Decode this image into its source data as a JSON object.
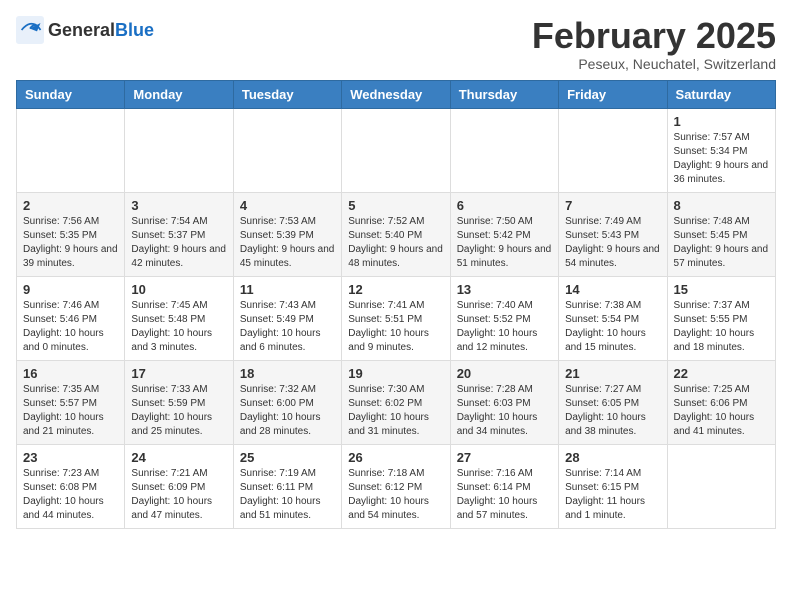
{
  "logo": {
    "general": "General",
    "blue": "Blue"
  },
  "title": "February 2025",
  "subtitle": "Peseux, Neuchatel, Switzerland",
  "weekdays": [
    "Sunday",
    "Monday",
    "Tuesday",
    "Wednesday",
    "Thursday",
    "Friday",
    "Saturday"
  ],
  "weeks": [
    [
      null,
      null,
      null,
      null,
      null,
      null,
      {
        "day": "1",
        "sunrise": "Sunrise: 7:57 AM",
        "sunset": "Sunset: 5:34 PM",
        "daylight": "Daylight: 9 hours and 36 minutes."
      }
    ],
    [
      {
        "day": "2",
        "sunrise": "Sunrise: 7:56 AM",
        "sunset": "Sunset: 5:35 PM",
        "daylight": "Daylight: 9 hours and 39 minutes."
      },
      {
        "day": "3",
        "sunrise": "Sunrise: 7:54 AM",
        "sunset": "Sunset: 5:37 PM",
        "daylight": "Daylight: 9 hours and 42 minutes."
      },
      {
        "day": "4",
        "sunrise": "Sunrise: 7:53 AM",
        "sunset": "Sunset: 5:39 PM",
        "daylight": "Daylight: 9 hours and 45 minutes."
      },
      {
        "day": "5",
        "sunrise": "Sunrise: 7:52 AM",
        "sunset": "Sunset: 5:40 PM",
        "daylight": "Daylight: 9 hours and 48 minutes."
      },
      {
        "day": "6",
        "sunrise": "Sunrise: 7:50 AM",
        "sunset": "Sunset: 5:42 PM",
        "daylight": "Daylight: 9 hours and 51 minutes."
      },
      {
        "day": "7",
        "sunrise": "Sunrise: 7:49 AM",
        "sunset": "Sunset: 5:43 PM",
        "daylight": "Daylight: 9 hours and 54 minutes."
      },
      {
        "day": "8",
        "sunrise": "Sunrise: 7:48 AM",
        "sunset": "Sunset: 5:45 PM",
        "daylight": "Daylight: 9 hours and 57 minutes."
      }
    ],
    [
      {
        "day": "9",
        "sunrise": "Sunrise: 7:46 AM",
        "sunset": "Sunset: 5:46 PM",
        "daylight": "Daylight: 10 hours and 0 minutes."
      },
      {
        "day": "10",
        "sunrise": "Sunrise: 7:45 AM",
        "sunset": "Sunset: 5:48 PM",
        "daylight": "Daylight: 10 hours and 3 minutes."
      },
      {
        "day": "11",
        "sunrise": "Sunrise: 7:43 AM",
        "sunset": "Sunset: 5:49 PM",
        "daylight": "Daylight: 10 hours and 6 minutes."
      },
      {
        "day": "12",
        "sunrise": "Sunrise: 7:41 AM",
        "sunset": "Sunset: 5:51 PM",
        "daylight": "Daylight: 10 hours and 9 minutes."
      },
      {
        "day": "13",
        "sunrise": "Sunrise: 7:40 AM",
        "sunset": "Sunset: 5:52 PM",
        "daylight": "Daylight: 10 hours and 12 minutes."
      },
      {
        "day": "14",
        "sunrise": "Sunrise: 7:38 AM",
        "sunset": "Sunset: 5:54 PM",
        "daylight": "Daylight: 10 hours and 15 minutes."
      },
      {
        "day": "15",
        "sunrise": "Sunrise: 7:37 AM",
        "sunset": "Sunset: 5:55 PM",
        "daylight": "Daylight: 10 hours and 18 minutes."
      }
    ],
    [
      {
        "day": "16",
        "sunrise": "Sunrise: 7:35 AM",
        "sunset": "Sunset: 5:57 PM",
        "daylight": "Daylight: 10 hours and 21 minutes."
      },
      {
        "day": "17",
        "sunrise": "Sunrise: 7:33 AM",
        "sunset": "Sunset: 5:59 PM",
        "daylight": "Daylight: 10 hours and 25 minutes."
      },
      {
        "day": "18",
        "sunrise": "Sunrise: 7:32 AM",
        "sunset": "Sunset: 6:00 PM",
        "daylight": "Daylight: 10 hours and 28 minutes."
      },
      {
        "day": "19",
        "sunrise": "Sunrise: 7:30 AM",
        "sunset": "Sunset: 6:02 PM",
        "daylight": "Daylight: 10 hours and 31 minutes."
      },
      {
        "day": "20",
        "sunrise": "Sunrise: 7:28 AM",
        "sunset": "Sunset: 6:03 PM",
        "daylight": "Daylight: 10 hours and 34 minutes."
      },
      {
        "day": "21",
        "sunrise": "Sunrise: 7:27 AM",
        "sunset": "Sunset: 6:05 PM",
        "daylight": "Daylight: 10 hours and 38 minutes."
      },
      {
        "day": "22",
        "sunrise": "Sunrise: 7:25 AM",
        "sunset": "Sunset: 6:06 PM",
        "daylight": "Daylight: 10 hours and 41 minutes."
      }
    ],
    [
      {
        "day": "23",
        "sunrise": "Sunrise: 7:23 AM",
        "sunset": "Sunset: 6:08 PM",
        "daylight": "Daylight: 10 hours and 44 minutes."
      },
      {
        "day": "24",
        "sunrise": "Sunrise: 7:21 AM",
        "sunset": "Sunset: 6:09 PM",
        "daylight": "Daylight: 10 hours and 47 minutes."
      },
      {
        "day": "25",
        "sunrise": "Sunrise: 7:19 AM",
        "sunset": "Sunset: 6:11 PM",
        "daylight": "Daylight: 10 hours and 51 minutes."
      },
      {
        "day": "26",
        "sunrise": "Sunrise: 7:18 AM",
        "sunset": "Sunset: 6:12 PM",
        "daylight": "Daylight: 10 hours and 54 minutes."
      },
      {
        "day": "27",
        "sunrise": "Sunrise: 7:16 AM",
        "sunset": "Sunset: 6:14 PM",
        "daylight": "Daylight: 10 hours and 57 minutes."
      },
      {
        "day": "28",
        "sunrise": "Sunrise: 7:14 AM",
        "sunset": "Sunset: 6:15 PM",
        "daylight": "Daylight: 11 hours and 1 minute."
      },
      null
    ]
  ]
}
